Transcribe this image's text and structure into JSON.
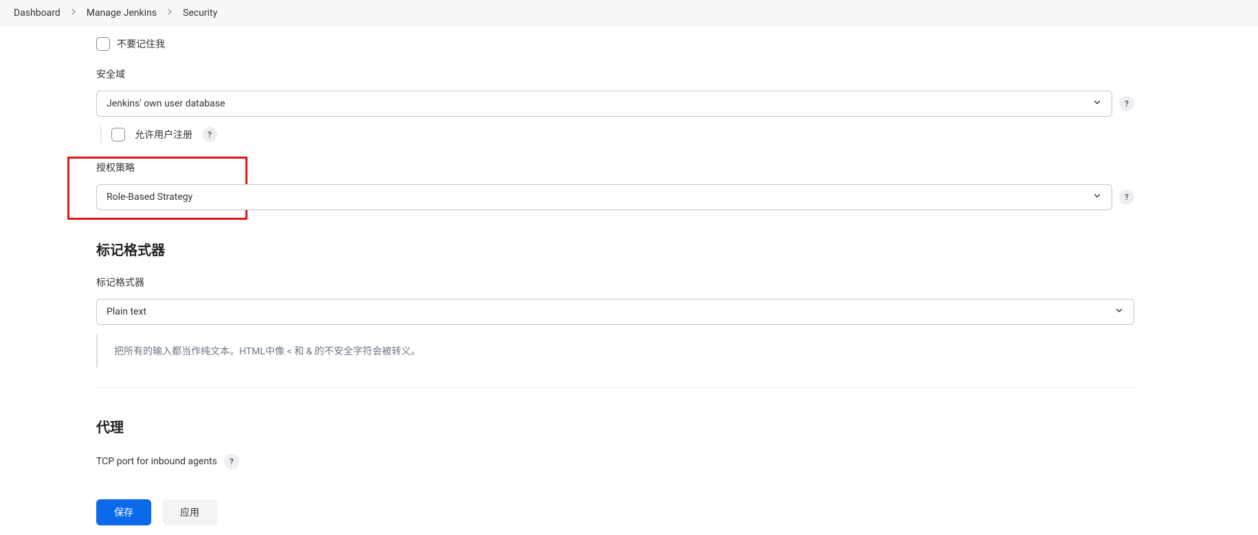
{
  "breadcrumb": {
    "items": [
      "Dashboard",
      "Manage Jenkins",
      "Security"
    ]
  },
  "checkbox": {
    "dont_remember_me": "不要记住我",
    "allow_signup": "允许用户注册"
  },
  "security_realm": {
    "label": "安全域",
    "selected": "Jenkins' own user database"
  },
  "authorization": {
    "label": "授权策略",
    "selected": "Role-Based Strategy"
  },
  "markup": {
    "section_title": "标记格式器",
    "field_label": "标记格式器",
    "selected": "Plain text",
    "help_text": "把所有的输入都当作纯文本。HTML中像 < 和 & 的不安全字符会被转义。"
  },
  "agents": {
    "section_title": "代理",
    "tcp_port_label": "TCP port for inbound agents"
  },
  "buttons": {
    "save": "保存",
    "apply": "应用"
  },
  "help_glyph": "?"
}
